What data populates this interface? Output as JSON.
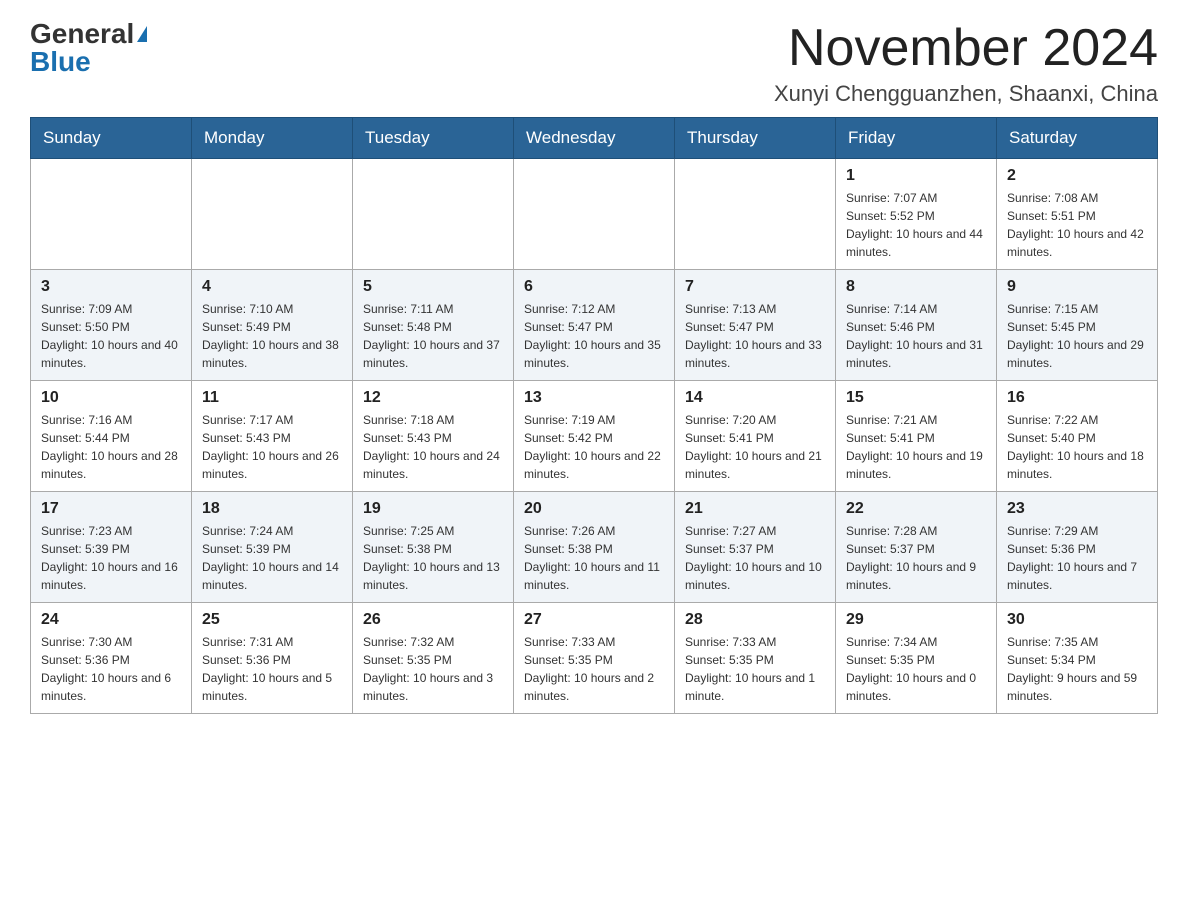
{
  "header": {
    "logo_general": "General",
    "logo_blue": "Blue",
    "title": "November 2024",
    "location": "Xunyi Chengguanzhen, Shaanxi, China"
  },
  "weekdays": [
    "Sunday",
    "Monday",
    "Tuesday",
    "Wednesday",
    "Thursday",
    "Friday",
    "Saturday"
  ],
  "weeks": [
    [
      {
        "day": "",
        "info": ""
      },
      {
        "day": "",
        "info": ""
      },
      {
        "day": "",
        "info": ""
      },
      {
        "day": "",
        "info": ""
      },
      {
        "day": "",
        "info": ""
      },
      {
        "day": "1",
        "info": "Sunrise: 7:07 AM\nSunset: 5:52 PM\nDaylight: 10 hours and 44 minutes."
      },
      {
        "day": "2",
        "info": "Sunrise: 7:08 AM\nSunset: 5:51 PM\nDaylight: 10 hours and 42 minutes."
      }
    ],
    [
      {
        "day": "3",
        "info": "Sunrise: 7:09 AM\nSunset: 5:50 PM\nDaylight: 10 hours and 40 minutes."
      },
      {
        "day": "4",
        "info": "Sunrise: 7:10 AM\nSunset: 5:49 PM\nDaylight: 10 hours and 38 minutes."
      },
      {
        "day": "5",
        "info": "Sunrise: 7:11 AM\nSunset: 5:48 PM\nDaylight: 10 hours and 37 minutes."
      },
      {
        "day": "6",
        "info": "Sunrise: 7:12 AM\nSunset: 5:47 PM\nDaylight: 10 hours and 35 minutes."
      },
      {
        "day": "7",
        "info": "Sunrise: 7:13 AM\nSunset: 5:47 PM\nDaylight: 10 hours and 33 minutes."
      },
      {
        "day": "8",
        "info": "Sunrise: 7:14 AM\nSunset: 5:46 PM\nDaylight: 10 hours and 31 minutes."
      },
      {
        "day": "9",
        "info": "Sunrise: 7:15 AM\nSunset: 5:45 PM\nDaylight: 10 hours and 29 minutes."
      }
    ],
    [
      {
        "day": "10",
        "info": "Sunrise: 7:16 AM\nSunset: 5:44 PM\nDaylight: 10 hours and 28 minutes."
      },
      {
        "day": "11",
        "info": "Sunrise: 7:17 AM\nSunset: 5:43 PM\nDaylight: 10 hours and 26 minutes."
      },
      {
        "day": "12",
        "info": "Sunrise: 7:18 AM\nSunset: 5:43 PM\nDaylight: 10 hours and 24 minutes."
      },
      {
        "day": "13",
        "info": "Sunrise: 7:19 AM\nSunset: 5:42 PM\nDaylight: 10 hours and 22 minutes."
      },
      {
        "day": "14",
        "info": "Sunrise: 7:20 AM\nSunset: 5:41 PM\nDaylight: 10 hours and 21 minutes."
      },
      {
        "day": "15",
        "info": "Sunrise: 7:21 AM\nSunset: 5:41 PM\nDaylight: 10 hours and 19 minutes."
      },
      {
        "day": "16",
        "info": "Sunrise: 7:22 AM\nSunset: 5:40 PM\nDaylight: 10 hours and 18 minutes."
      }
    ],
    [
      {
        "day": "17",
        "info": "Sunrise: 7:23 AM\nSunset: 5:39 PM\nDaylight: 10 hours and 16 minutes."
      },
      {
        "day": "18",
        "info": "Sunrise: 7:24 AM\nSunset: 5:39 PM\nDaylight: 10 hours and 14 minutes."
      },
      {
        "day": "19",
        "info": "Sunrise: 7:25 AM\nSunset: 5:38 PM\nDaylight: 10 hours and 13 minutes."
      },
      {
        "day": "20",
        "info": "Sunrise: 7:26 AM\nSunset: 5:38 PM\nDaylight: 10 hours and 11 minutes."
      },
      {
        "day": "21",
        "info": "Sunrise: 7:27 AM\nSunset: 5:37 PM\nDaylight: 10 hours and 10 minutes."
      },
      {
        "day": "22",
        "info": "Sunrise: 7:28 AM\nSunset: 5:37 PM\nDaylight: 10 hours and 9 minutes."
      },
      {
        "day": "23",
        "info": "Sunrise: 7:29 AM\nSunset: 5:36 PM\nDaylight: 10 hours and 7 minutes."
      }
    ],
    [
      {
        "day": "24",
        "info": "Sunrise: 7:30 AM\nSunset: 5:36 PM\nDaylight: 10 hours and 6 minutes."
      },
      {
        "day": "25",
        "info": "Sunrise: 7:31 AM\nSunset: 5:36 PM\nDaylight: 10 hours and 5 minutes."
      },
      {
        "day": "26",
        "info": "Sunrise: 7:32 AM\nSunset: 5:35 PM\nDaylight: 10 hours and 3 minutes."
      },
      {
        "day": "27",
        "info": "Sunrise: 7:33 AM\nSunset: 5:35 PM\nDaylight: 10 hours and 2 minutes."
      },
      {
        "day": "28",
        "info": "Sunrise: 7:33 AM\nSunset: 5:35 PM\nDaylight: 10 hours and 1 minute."
      },
      {
        "day": "29",
        "info": "Sunrise: 7:34 AM\nSunset: 5:35 PM\nDaylight: 10 hours and 0 minutes."
      },
      {
        "day": "30",
        "info": "Sunrise: 7:35 AM\nSunset: 5:34 PM\nDaylight: 9 hours and 59 minutes."
      }
    ]
  ]
}
